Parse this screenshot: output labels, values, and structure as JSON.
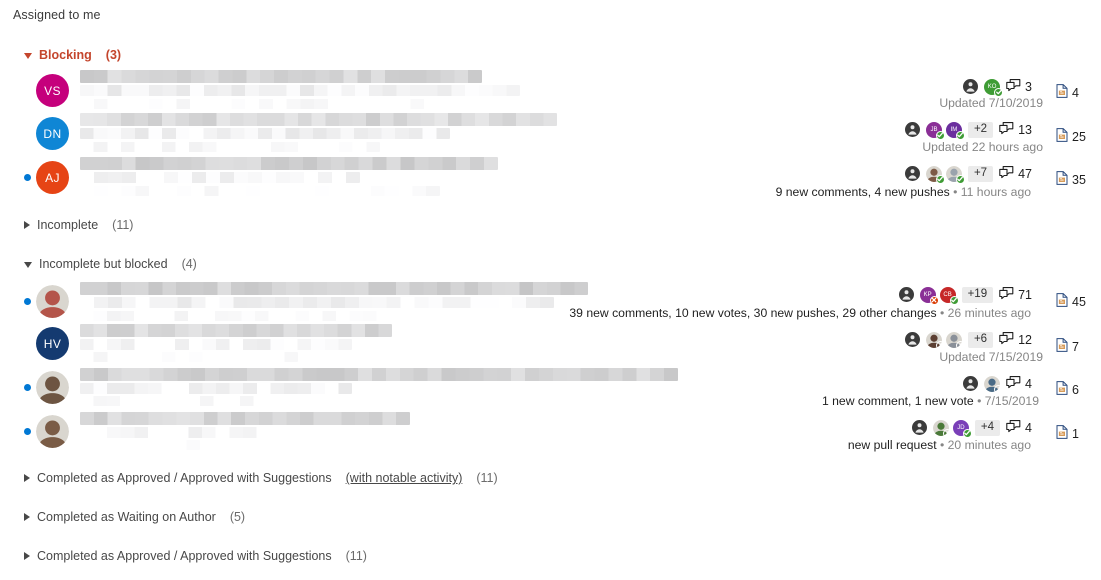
{
  "page": {
    "label": "Assigned to me"
  },
  "icons": {
    "author": "person-icon",
    "comments": "comment-bubbles-icon",
    "files": "file-diff-icon",
    "collapse": "chevron-down-icon",
    "expand": "chevron-right-icon",
    "approve": "check-icon",
    "reject": "x-icon",
    "waiting": "clock-icon"
  },
  "colors": {
    "blocking_header": "#c4452c",
    "normal_header": "#484848",
    "unread_dot": "#0078d4",
    "approve": "#3f9c35",
    "reject": "#da3b01",
    "waiting": "#f2a20c",
    "overflow_badge_bg": "#ebebeb"
  },
  "groups": [
    {
      "id": "blocking",
      "label": "Blocking",
      "count": "(3)",
      "expanded": true,
      "style": "blocking"
    },
    {
      "id": "incomplete",
      "label": "Incomplete",
      "count": "(11)",
      "expanded": false,
      "style": "normal"
    },
    {
      "id": "incomplete-but-blocked",
      "label": "Incomplete but blocked",
      "count": "(4)",
      "expanded": true,
      "style": "normal"
    },
    {
      "id": "completed-approved-notable",
      "label": "Completed as Approved / Approved with Suggestions",
      "underline": "(with notable activity)",
      "count": "(11)",
      "expanded": false,
      "style": "normal"
    },
    {
      "id": "completed-waiting-on-author",
      "label": "Completed as Waiting on Author",
      "count": "(5)",
      "expanded": false,
      "style": "normal"
    },
    {
      "id": "completed-approved",
      "label": "Completed as Approved / Approved with Suggestions",
      "count": "(11)",
      "expanded": false,
      "style": "normal"
    }
  ],
  "rows": [
    {
      "id": "row-blocking-1",
      "unread": false,
      "avatar": {
        "type": "initials",
        "initials": "VS",
        "color": "#c5007c"
      },
      "reviewers": [
        {
          "type": "initials",
          "initials": "KO",
          "color": "#3f9c35",
          "vote": "approve"
        }
      ],
      "overflow": null,
      "comments": "3",
      "files": "4",
      "status_text": "",
      "timestamp": "Updated 7/10/2019",
      "status_muted": true
    },
    {
      "id": "row-blocking-2",
      "unread": false,
      "avatar": {
        "type": "initials",
        "initials": "DN",
        "color": "#0f86d5"
      },
      "reviewers": [
        {
          "type": "initials",
          "initials": "JB",
          "color": "#8a2f96",
          "vote": "approve"
        },
        {
          "type": "initials",
          "initials": "IM",
          "color": "#6b2f9e",
          "vote": "approve"
        }
      ],
      "overflow": "+2",
      "comments": "13",
      "files": "25",
      "status_text": "",
      "timestamp": "Updated 22 hours ago",
      "status_muted": true
    },
    {
      "id": "row-blocking-3",
      "unread": true,
      "avatar": {
        "type": "initials",
        "initials": "AJ",
        "color": "#e64415"
      },
      "reviewers": [
        {
          "type": "photo",
          "color": "#7d5b46",
          "vote": "approve"
        },
        {
          "type": "photo",
          "color": "#9aa3ad",
          "vote": "approve"
        }
      ],
      "overflow": "+7",
      "comments": "47",
      "files": "35",
      "status_text": "9 new comments, 4 new pushes",
      "timestamp": "11 hours ago",
      "status_muted": false
    },
    {
      "id": "row-blocked-1",
      "unread": true,
      "avatar": {
        "type": "photo",
        "color": "#b4554a"
      },
      "reviewers": [
        {
          "type": "initials",
          "initials": "KP",
          "color": "#8a2f96",
          "vote": "reject"
        },
        {
          "type": "initials",
          "initials": "CB",
          "color": "#c62828",
          "vote": "approve"
        }
      ],
      "overflow": "+19",
      "comments": "71",
      "files": "45",
      "status_text": "39 new comments, 10 new votes, 30 new pushes, 29 other changes",
      "timestamp": "26 minutes ago",
      "status_muted": false
    },
    {
      "id": "row-blocked-2",
      "unread": false,
      "avatar": {
        "type": "initials",
        "initials": "HV",
        "color": "#143a70"
      },
      "reviewers": [
        {
          "type": "photo",
          "color": "#5c4033",
          "vote": "waiting"
        },
        {
          "type": "photo",
          "color": "#8a9099",
          "vote": "waiting"
        }
      ],
      "overflow": "+6",
      "comments": "12",
      "files": "7",
      "status_text": "",
      "timestamp": "Updated 7/15/2019",
      "status_muted": true
    },
    {
      "id": "row-blocked-3",
      "unread": true,
      "avatar": {
        "type": "photo",
        "color": "#6d5542"
      },
      "reviewers": [
        {
          "type": "photo",
          "color": "#4a6b86",
          "vote": "waiting"
        }
      ],
      "overflow": null,
      "comments": "4",
      "files": "6",
      "status_text": "1 new comment, 1 new vote",
      "timestamp": "7/15/2019",
      "status_muted": false
    },
    {
      "id": "row-blocked-4",
      "unread": true,
      "avatar": {
        "type": "photo",
        "color": "#7a5c46"
      },
      "reviewers": [
        {
          "type": "photo",
          "color": "#4b7a3a",
          "vote": "waiting"
        },
        {
          "type": "initials",
          "initials": "JD",
          "color": "#7a3fb8",
          "vote": "approve"
        }
      ],
      "overflow": "+4",
      "comments": "4",
      "files": "1",
      "status_text": "new pull request",
      "timestamp": "20 minutes ago",
      "status_muted": false
    }
  ]
}
